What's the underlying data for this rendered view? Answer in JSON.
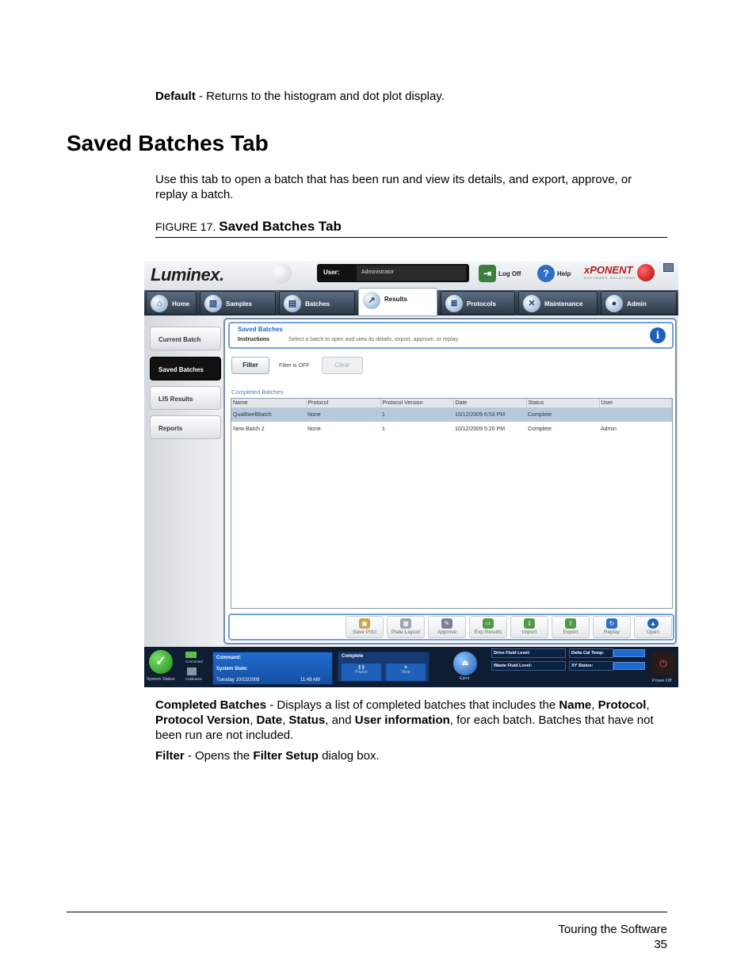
{
  "doc": {
    "default_term": "Default",
    "default_desc": " - Returns to the histogram and dot plot display.",
    "heading": "Saved Batches Tab",
    "intro": "Use this tab to open a batch that has been run and view its details, and export, approve, or replay a batch.",
    "figure_num": "FIGURE 17.",
    "figure_title": "Saved Batches Tab",
    "cb_term": "Completed Batches",
    "cb_t1": " - Displays a list of completed batches that includes the ",
    "cb_name": "Name",
    "cb_c1": ",",
    "cb_protocol": "Protocol",
    "cb_c2": ", ",
    "cb_pv": "Protocol Version",
    "cb_c3": ", ",
    "cb_date": "Date",
    "cb_c4": ", ",
    "cb_status": "Status",
    "cb_and": ", and ",
    "cb_user": "User information",
    "cb_t2": ", for each batch. Batches that have not been run are not included.",
    "filter_term": "Filter",
    "filter_t1": " - Opens the ",
    "filter_setup": "Filter Setup",
    "filter_t2": " dialog box.",
    "footer_section": "Touring the Software",
    "footer_page": "35"
  },
  "app": {
    "logo": "Luminex.",
    "user_label": "User:",
    "user_value": "Administrator",
    "logoff": "Log Off",
    "help": "Help",
    "brand": "xPONENT",
    "brand_sub": "SOFTWARE SOLUTIONS",
    "tabs": [
      "Home",
      "Samples",
      "Batches",
      "Results",
      "Protocols",
      "Maintenance",
      "Admin"
    ],
    "sidebar": [
      "Current Batch",
      "Saved Batches",
      "LIS Results",
      "Reports"
    ],
    "panel_title": "Saved Batches",
    "instructions_label": "Instructions",
    "instructions_text": "Select a batch to open and view its details, export, approve, or replay.",
    "filter_btn": "Filter",
    "filter_status": "Filter is OFF",
    "clear_btn": "Clear",
    "completed_label": "Completed Batches",
    "columns": [
      "Name",
      "Protocol",
      "Protocol Version",
      "Date",
      "Status",
      "User"
    ],
    "rows": [
      [
        "Qual8wellBatch",
        "None",
        "1",
        "10/12/2009 6:53 PM",
        "Complete",
        ""
      ],
      [
        "New Batch 2",
        "None",
        "1",
        "10/12/2009 5:20 PM",
        "Complete",
        "Admin"
      ]
    ],
    "actions": [
      "Save Prtcl",
      "Plate Layout",
      "Approve",
      "Exp Results",
      "Import",
      "Export",
      "Replay",
      "Open"
    ],
    "status": {
      "system_status": "System Status",
      "connected": "Connected",
      "calibrated": "Calibrated",
      "command": "Command:",
      "system_state": "System State:",
      "datetime": "Tuesday 10/13/2009",
      "time": "11:49 AM",
      "state": "Complete",
      "pause": "Pause",
      "stop": "Stop",
      "eject": "Eject",
      "drive_fluid": "Drive Fluid Level:",
      "waste_fluid": "Waste Fluid Level:",
      "delta_cal": "Delta Cal Temp:",
      "xy_status": "XY Status:",
      "power_off": "Power Off"
    }
  }
}
